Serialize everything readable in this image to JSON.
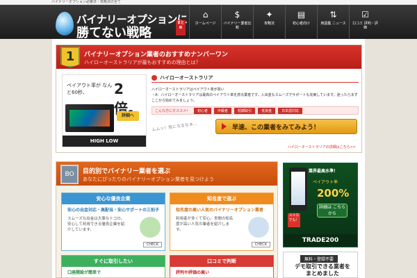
{
  "topbar": {
    "text": "バイナリーオプション必勝法・攻略法の全て"
  },
  "header": {
    "logo_line1": "バイナリーオプションに",
    "logo_line2": "勝てない戦略",
    "logo_badge": "まとめ",
    "nav": [
      {
        "icon": "home-icon",
        "glyph": "⌂",
        "label": "ホームページ"
      },
      {
        "icon": "money-icon",
        "glyph": "$",
        "label": "バイナリー業者比較"
      },
      {
        "icon": "bulb-icon",
        "glyph": "✦",
        "label": "攻略法"
      },
      {
        "icon": "book-icon",
        "glyph": "▤",
        "label": "初心者向け"
      },
      {
        "icon": "updown-icon",
        "glyph": "⇅",
        "label": "用語集 ニュース"
      },
      {
        "icon": "checklist-icon",
        "glyph": "☑",
        "label": "口コミ 評判・評価"
      }
    ]
  },
  "section1": {
    "badge": "1",
    "title": "バイナリーオプション業者のおすすめナンバーワン",
    "subtitle": "ハイローオーストラリアが最もおすすめの理由とは？",
    "ad": {
      "text": "ペイアウト率が なんと60秒、",
      "big": "2倍。",
      "button": "詳細へ",
      "logo": "HIGH LOW"
    },
    "heading": "ハイローオーストラリア",
    "line1": "ハイローオーストラリアはペイアウト率が高い",
    "line2": "・A：ハイローオーストラリアは最高のペイアウト率を誇る業者です。入出金もスムーズでサポートも充実しています。迷ったらまずここから始めてみましょう。",
    "tags_label": "こんな方にオススメ！",
    "tags": [
      "初心者",
      "中級者",
      "短期取引",
      "低資金",
      "日本語対応"
    ],
    "handwrite": "ムムッ！気になるなぁ…",
    "cta": "早速、この業者をみてみよう！",
    "link": "ハイローオーストラリアの詳細はこちら>>"
  },
  "section2": {
    "badge": "BO",
    "title": "目的別でバイナリー業者を選ぶ",
    "subtitle": "あなたにぴったりのバイナリーオプション業者を見つけよう",
    "cards": [
      {
        "title": "安心な優良企業",
        "lead": "安心の出金対応・高配当・安心サポートの三拍子",
        "body": "スムーズな出金は大事なトコロ。安心して利用できる優良企業を紹介しています。",
        "check": "CHECK"
      },
      {
        "title": "知名度で選ぶ",
        "lead": "知名度の高い人気のバイナリーオプション業者",
        "body": "利用者が多くて安心。世間の知名度が高い人気の業者を紹介します。",
        "check": "CHECK"
      },
      {
        "title": "すぐに取引したい",
        "lead": "口座開設が簡単で",
        "body": "",
        "check": ""
      },
      {
        "title": "口コミで判断",
        "lead": "評判や評価の高い",
        "body": "",
        "check": ""
      }
    ]
  },
  "ad2": {
    "top": "業界最高水準！",
    "rate_label": "ペイアウト率",
    "rate": "200%",
    "btn": "詳細は こちらから",
    "stamp": "スマホでも！",
    "logo": "TRADE200"
  },
  "ad3": {
    "top": "無料・登録不要",
    "main": "デモ取引できる業者をまとめました"
  }
}
